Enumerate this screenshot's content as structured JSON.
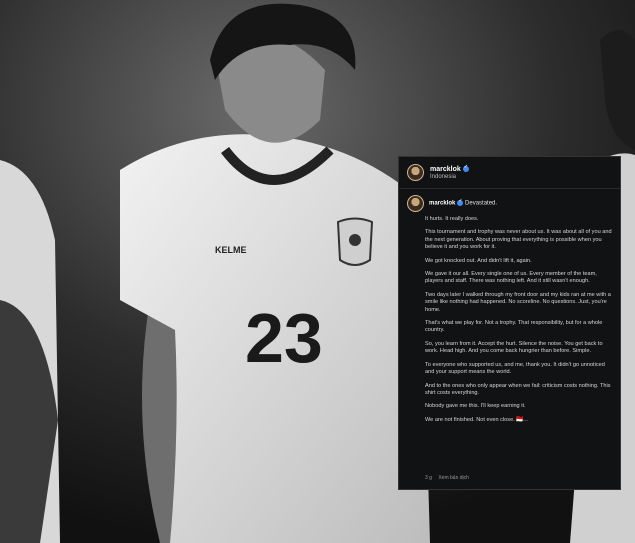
{
  "post": {
    "username": "marcklok",
    "location": "Indonesia",
    "caption_head": "Devastated.",
    "paragraphs": [
      "It hurts. It really does.",
      "This tournament and trophy was never about us. It was about all of you and the next generation. About proving that everything is possible when you believe it and you work for it.",
      "We got knocked out. And didn't lift it, again.",
      "We gave it our all. Every single one of us. Every member of the team, players and staff. There was nothing left. And it still wasn't enough.",
      "Two days later I walked through my front door and my kids ran at me with a smile like nothing had happened. No scoreline. No questions. Just, you're home.",
      "That's what we play for. Not a trophy. That responsibility, but for a whole country.",
      "So, you learn from it. Accept the hurt. Silence the noise. You get back to work. Head high. And you come back hungrier than before. Simple.",
      "To everyone who supported us, and me, thank you. It didn't go unnoticed and your support means the world.",
      "And to the ones who only appear when we fail: criticism costs nothing. This shirt costs everything.",
      "Nobody gave me this. I'll keep earning it.",
      "We are not finished. Not even close. 🇮🇩..."
    ],
    "time": "3 g",
    "translate": "Xem bản dịch"
  },
  "photo": {
    "shirt_number": "23",
    "brand": "KELME"
  }
}
